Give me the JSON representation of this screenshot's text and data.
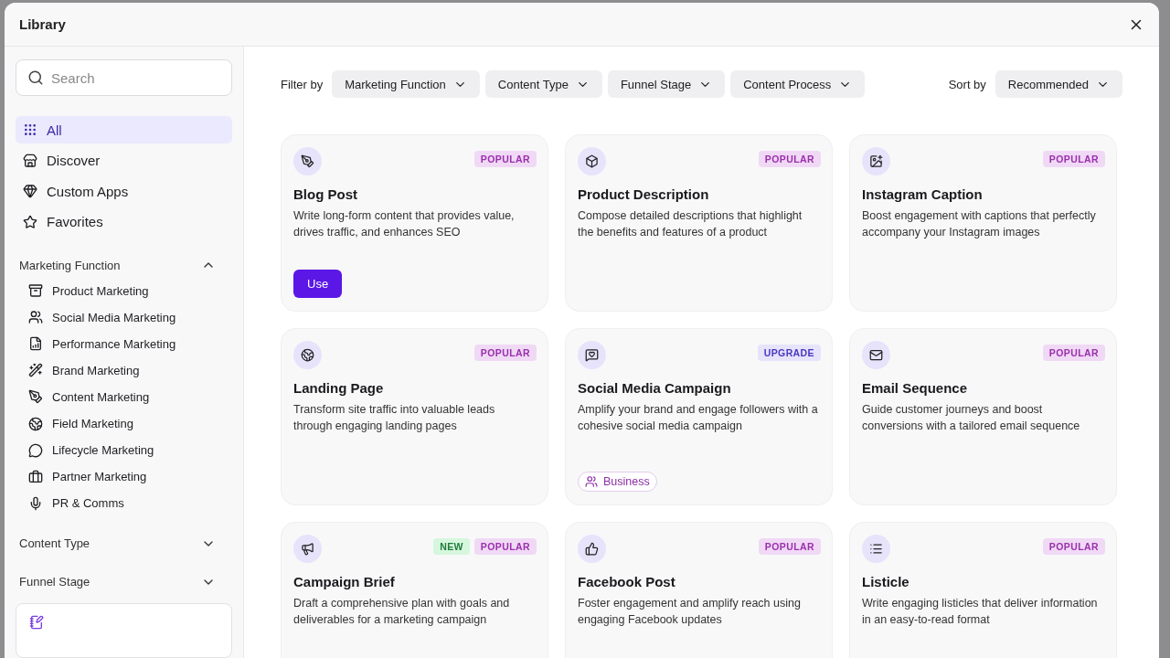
{
  "window": {
    "title": "Library"
  },
  "sidebar": {
    "search": {
      "placeholder": "Search"
    },
    "nav": [
      {
        "label": "All",
        "selected": true
      },
      {
        "label": "Discover",
        "selected": false
      },
      {
        "label": "Custom Apps",
        "selected": false
      },
      {
        "label": "Favorites",
        "selected": false
      }
    ],
    "sections": [
      {
        "title": "Marketing Function",
        "expanded": true,
        "items": [
          "Product Marketing",
          "Social Media Marketing",
          "Performance Marketing",
          "Brand Marketing",
          "Content Marketing",
          "Field Marketing",
          "Lifecycle Marketing",
          "Partner Marketing",
          "PR & Comms"
        ]
      },
      {
        "title": "Content Type",
        "expanded": false
      },
      {
        "title": "Funnel Stage",
        "expanded": false
      }
    ]
  },
  "filters": {
    "label": "Filter by",
    "options": [
      "Marketing Function",
      "Content Type",
      "Funnel Stage",
      "Content Process"
    ],
    "sort_label": "Sort by",
    "sort_value": "Recommended"
  },
  "cards": [
    {
      "title": "Blog Post",
      "description": "Write long-form content that provides value, drives traffic, and enhances SEO",
      "badges": [
        {
          "kind": "popular",
          "text": "POPULAR"
        }
      ],
      "action": "Use"
    },
    {
      "title": "Product Description",
      "description": "Compose detailed descriptions that highlight the benefits and features of a product",
      "badges": [
        {
          "kind": "popular",
          "text": "POPULAR"
        }
      ]
    },
    {
      "title": "Instagram Caption",
      "description": "Boost engagement with captions that perfectly accompany your Instagram images",
      "badges": [
        {
          "kind": "popular",
          "text": "POPULAR"
        }
      ]
    },
    {
      "title": "Landing Page",
      "description": "Transform site traffic into valuable leads through engaging landing pages",
      "badges": [
        {
          "kind": "popular",
          "text": "POPULAR"
        }
      ]
    },
    {
      "title": "Social Media Campaign",
      "description": "Amplify your brand and engage followers with a cohesive social media campaign",
      "badges": [
        {
          "kind": "upgrade",
          "text": "UPGRADE"
        }
      ],
      "tag": "Business"
    },
    {
      "title": "Email Sequence",
      "description": "Guide customer journeys and boost conversions with a tailored email sequence",
      "badges": [
        {
          "kind": "popular",
          "text": "POPULAR"
        }
      ]
    },
    {
      "title": "Campaign Brief",
      "description": "Draft a comprehensive plan with goals and deliverables for a marketing campaign",
      "badges": [
        {
          "kind": "new",
          "text": "NEW"
        },
        {
          "kind": "popular",
          "text": "POPULAR"
        }
      ]
    },
    {
      "title": "Facebook Post",
      "description": "Foster engagement and amplify reach using engaging Facebook updates",
      "badges": [
        {
          "kind": "popular",
          "text": "POPULAR"
        }
      ]
    },
    {
      "title": "Listicle",
      "description": "Write engaging listicles that deliver information in an easy-to-read format",
      "badges": [
        {
          "kind": "popular",
          "text": "POPULAR"
        }
      ]
    }
  ]
}
